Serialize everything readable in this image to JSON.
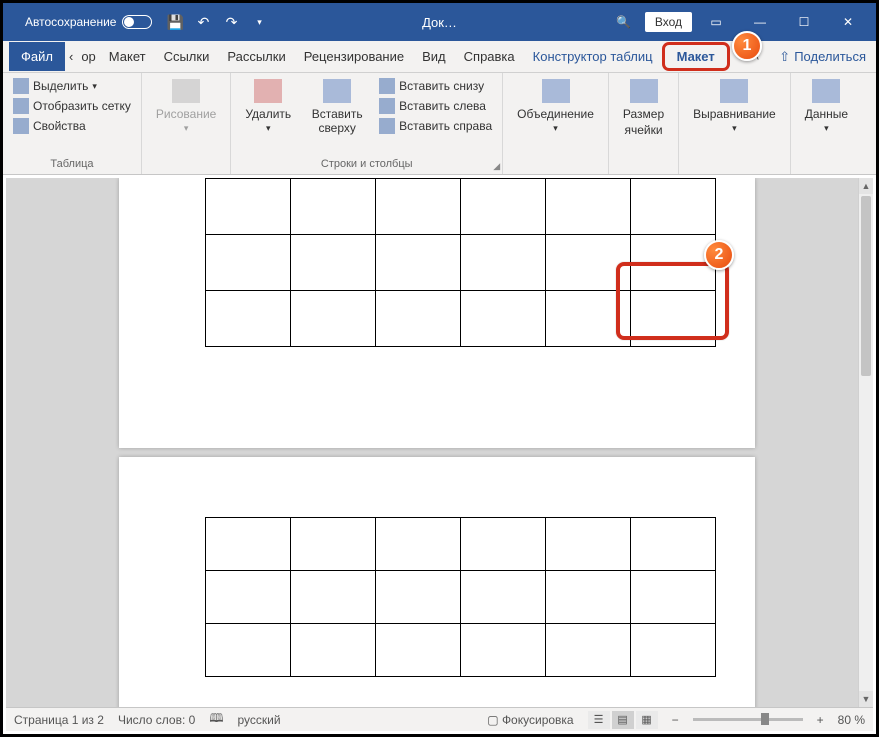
{
  "titlebar": {
    "autosave": "Автосохранение",
    "doc_title": "Док…",
    "login": "Вход"
  },
  "tabs": {
    "file": "Файл",
    "nav_prev": "‹",
    "truncated": "ор",
    "maket": "Макет",
    "links": "Ссылки",
    "mailings": "Рассылки",
    "review": "Рецензирование",
    "view": "Вид",
    "help": "Справка",
    "table_design": "Конструктор таблиц",
    "layout": "Макет",
    "share": "Поделиться"
  },
  "ribbon": {
    "table_group": "Таблица",
    "select": "Выделить",
    "show_grid": "Отобразить сетку",
    "properties": "Свойства",
    "draw_group": "Рисование",
    "delete": "Удалить",
    "insert_above": "Вставить сверху",
    "insert_below": "Вставить снизу",
    "insert_left": "Вставить слева",
    "insert_right": "Вставить справа",
    "rows_cols_group": "Строки и столбцы",
    "merge": "Объединение",
    "cell_size_l1": "Размер",
    "cell_size_l2": "ячейки",
    "alignment": "Выравнивание",
    "data": "Данные"
  },
  "callouts": {
    "one": "1",
    "two": "2"
  },
  "status": {
    "page": "Страница 1 из 2",
    "words": "Число слов: 0",
    "lang": "русский",
    "focus": "Фокусировка",
    "zoom": "80 %"
  }
}
